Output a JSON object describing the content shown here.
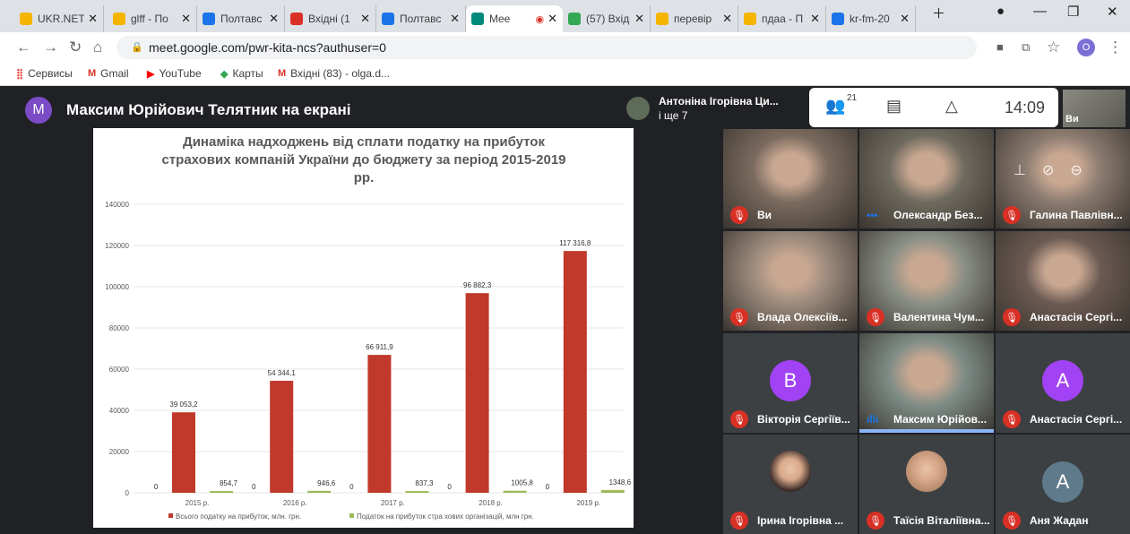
{
  "tabs": [
    {
      "title": "UKR.NET",
      "icon": "ukrnet-icon",
      "color": "#f4b400",
      "active": false
    },
    {
      "title": "glff - По",
      "icon": "yellow-doc-icon",
      "color": "#f4b400",
      "active": false
    },
    {
      "title": "Полтавс",
      "icon": "globe-icon",
      "color": "#1a73e8",
      "active": false
    },
    {
      "title": "Вхідні (1",
      "icon": "gmail-icon",
      "color": "#d93025",
      "active": false
    },
    {
      "title": "Полтавс",
      "icon": "calendar-icon",
      "color": "#1a73e8",
      "active": false
    },
    {
      "title": "Mee",
      "icon": "meet-icon",
      "color": "#00897b",
      "active": true
    },
    {
      "title": "(57) Вхід",
      "icon": "inbox-icon",
      "color": "#34a853",
      "active": false
    },
    {
      "title": "перевір",
      "icon": "yellow-doc-icon",
      "color": "#f4b400",
      "active": false
    },
    {
      "title": "пдаа - П",
      "icon": "yellow-doc-icon",
      "color": "#f4b400",
      "active": false
    },
    {
      "title": "kr-fm-20",
      "icon": "globe-icon",
      "color": "#1a73e8",
      "active": false
    }
  ],
  "url": "meet.google.com/pwr-kita-ncs?authuser=0",
  "profile_initial": "O",
  "bookmarks": [
    {
      "label": "Сервисы",
      "icon": "apps-grid-icon",
      "color": "#ea4335"
    },
    {
      "label": "Gmail",
      "icon": "gmail-icon",
      "color": "#d93025"
    },
    {
      "label": "YouTube",
      "icon": "youtube-icon",
      "color": "#ff0000"
    },
    {
      "label": "Карты",
      "icon": "maps-icon",
      "color": "#34a853"
    },
    {
      "label": "Вхідні (83) - olga.d...",
      "icon": "gmail-icon",
      "color": "#d93025"
    }
  ],
  "meet": {
    "presenter_initial": "M",
    "presenter_title": "Максим Юрійович Телятник на екрані",
    "participant_name": "Антоніна Ігорівна Ци...",
    "participant_more": "і ще 7",
    "people_count": "21",
    "time": "14:09",
    "self_label": "Ви"
  },
  "tiles": [
    {
      "name": "Ви",
      "muted": true,
      "type": "video",
      "bg": "#7a6a5e"
    },
    {
      "name": "Олександр Без...",
      "muted": false,
      "type": "video",
      "bg": "#6e6a5e",
      "speaking": false,
      "dots": true
    },
    {
      "name": "Галина Павлівн...",
      "muted": true,
      "type": "video",
      "bg": "#8b7b70",
      "hover": true
    },
    {
      "name": "Влада Олексіїв...",
      "muted": true,
      "type": "video",
      "bg": "#9c8a7c"
    },
    {
      "name": "Валентина Чум...",
      "muted": true,
      "type": "video",
      "bg": "#8a8f86"
    },
    {
      "name": "Анастасія Сергі...",
      "muted": true,
      "type": "video",
      "bg": "#6b5a52"
    },
    {
      "name": "Вікторія Сергіїв...",
      "muted": true,
      "type": "letter",
      "letter": "B",
      "color": "#a142f4"
    },
    {
      "name": "Максим Юрійов...",
      "muted": false,
      "type": "video",
      "bg": "#7e8c86",
      "speaking": true
    },
    {
      "name": "Анастасія Сергі...",
      "muted": true,
      "type": "letter",
      "letter": "A",
      "color": "#a142f4"
    },
    {
      "name": "Ірина Ігорівна ...",
      "muted": true,
      "type": "face",
      "color": "#3b2b28"
    },
    {
      "name": "Таїсія Віталіївна...",
      "muted": true,
      "type": "face",
      "color": "#b98b6e"
    },
    {
      "name": "Аня Жадан",
      "muted": true,
      "type": "letter",
      "letter": "A",
      "color": "#5f7a8a"
    }
  ],
  "chart_data": {
    "type": "bar",
    "title": "Динаміка надходжень від сплати податку на прибуток страхових компаній України до бюджету за період 2015-2019 рр.",
    "title_lines": [
      "Динаміка надходжень від сплати податку на прибуток",
      "страхових компаній України до бюджету за період 2015-2019",
      "рр."
    ],
    "categories": [
      "2015 р.",
      "2016 р.",
      "2017 р.",
      "2018 р.",
      "2019 р."
    ],
    "series": [
      {
        "name": "Всього податку на прибуток, млн. грн.",
        "color": "#c0392b",
        "values": [
          39053.2,
          54344.1,
          66911.9,
          96882.3,
          117316.8
        ],
        "labels": [
          "39 053,2",
          "54 344,1",
          "66 911,9",
          "96 882,3",
          "117 316,8"
        ]
      },
      {
        "name": "Податок на прибуток стра хових організацій, млн грн.",
        "color": "#9bbb59",
        "values": [
          854.7,
          946.6,
          837.3,
          1005.8,
          1348.6
        ],
        "labels": [
          "854,7",
          "946,6",
          "837,3",
          "1005,8",
          "1348,6"
        ]
      }
    ],
    "zero_labels": [
      "0",
      "0",
      "0",
      "0",
      "0"
    ],
    "ylim": [
      0,
      140000
    ],
    "yticks": [
      "0",
      "20000",
      "40000",
      "60000",
      "80000",
      "100000",
      "120000",
      "140000"
    ],
    "grid": true,
    "legend": "bottom"
  }
}
